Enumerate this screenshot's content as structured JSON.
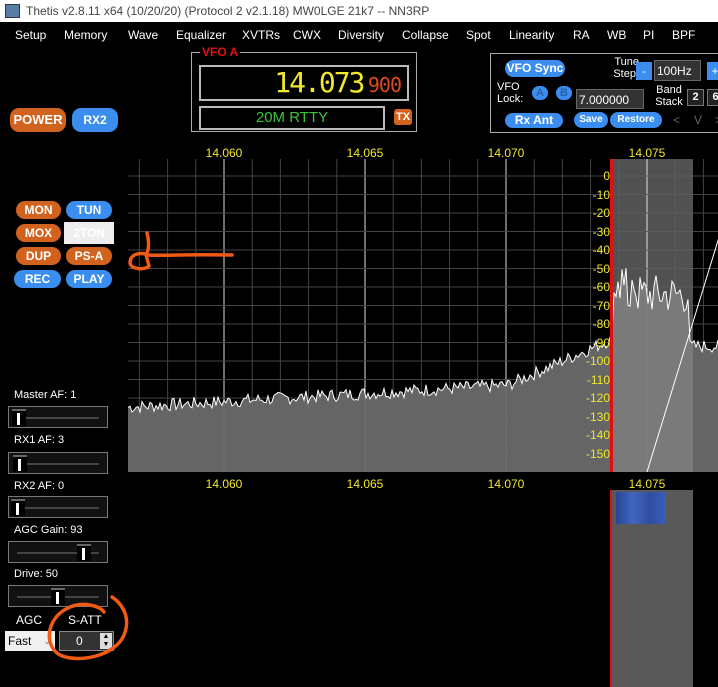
{
  "window": {
    "title": "Thetis v2.8.11 x64 (10/20/20) (Protocol 2 v2.1.18) MW0LGE 21k7   --   NN3RP"
  },
  "menu": [
    "Setup",
    "Memory",
    "Wave",
    "Equalizer",
    "XVTRs",
    "CWX",
    "Diversity",
    "Collapse",
    "Spot",
    "Linearity",
    "RA",
    "WB",
    "PI",
    "BPF"
  ],
  "buttons": {
    "power": "POWER",
    "rx2": "RX2",
    "mon": "MON",
    "tun": "TUN",
    "mox": "MOX",
    "twotone": "2TON",
    "dup": "DUP",
    "psa": "PS-A",
    "rec": "REC",
    "play": "PLAY"
  },
  "vfo_a": {
    "title": "VFO A",
    "freq_main": "14.073",
    "freq_sub": "900",
    "mode": "20M RTTY",
    "tx": "TX"
  },
  "right_panel": {
    "vfo_sync": "VFO Sync",
    "tune_step_label": "Tune Step:",
    "tune_minus": "-",
    "tune_step": "100Hz",
    "tune_plus": "+",
    "vfo_lock_label": "VFO Lock:",
    "lock_a": "A",
    "lock_b": "B",
    "lock_freq": "7.000000",
    "band_stack_label": "Band Stack",
    "band_stack_1": "2",
    "band_stack_2": "6",
    "rx_ant": "Rx Ant",
    "save": "Save",
    "restore": "Restore",
    "nav_prev": "<",
    "nav_down": "V",
    "nav_next": ">"
  },
  "panadapter": {
    "freq_labels": [
      "14.060",
      "14.065",
      "14.070",
      "14.075"
    ],
    "db_labels": [
      "0",
      "-10",
      "-20",
      "-30",
      "-40",
      "-50",
      "-60",
      "-70",
      "-80",
      "-90",
      "-100",
      "-110",
      "-120",
      "-130",
      "-140",
      "-150"
    ],
    "vfo_marker_color": "#e01010",
    "trace_color": "#ffffff",
    "filter_low": "14.0739",
    "filter_high": "14.0768"
  },
  "controls": {
    "master_af_label": "Master AF:",
    "master_af": "1",
    "rx1_af_label": "RX1 AF:",
    "rx1_af": "3",
    "rx2_af_label": "RX2 AF:",
    "rx2_af": "0",
    "agc_gain_label": "AGC Gain:",
    "agc_gain": "93",
    "drive_label": "Drive:",
    "drive": "50",
    "agc_label": "AGC",
    "agc_mode": "Fast",
    "satt_label": "S-ATT",
    "satt_value": "0"
  },
  "annotation_color": "#f05a14"
}
